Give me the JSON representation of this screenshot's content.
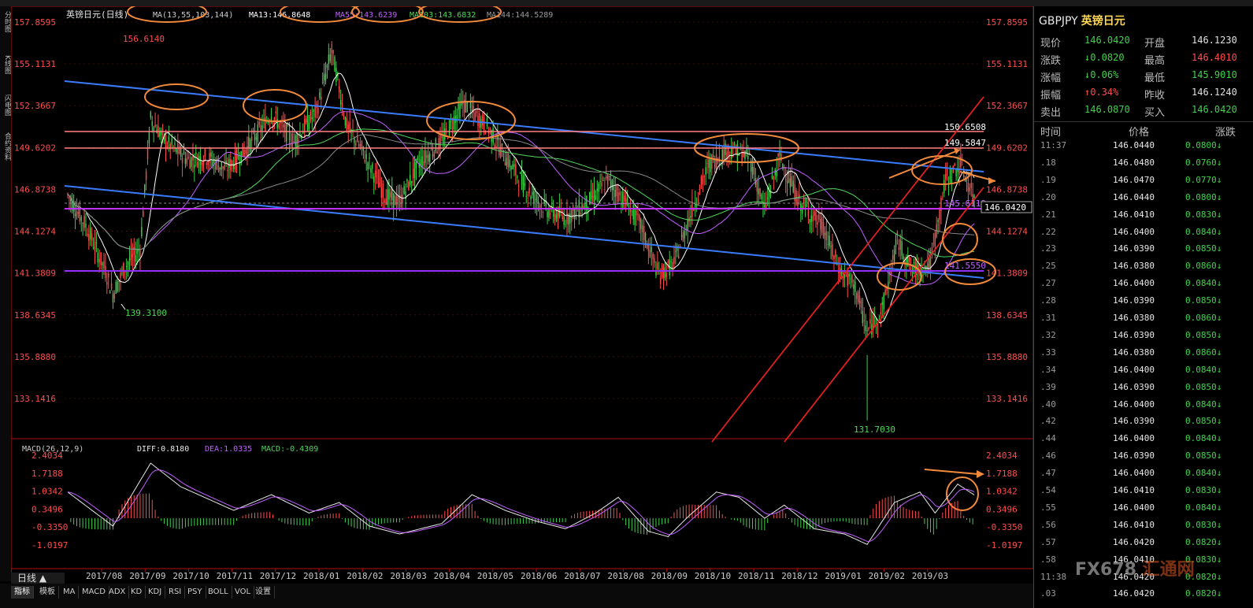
{
  "symbol": "GBPJPY",
  "name": "英镑日元",
  "chart_title": "英镑日元(日线)",
  "ma": {
    "params": "MA(13,55,103,144)",
    "ma13": "MA13:146.8648",
    "ma55": "MA55:143.6239",
    "ma103": "MA103:143.6832",
    "ma144": "MA144:144.5289"
  },
  "macd": {
    "params": "MACD(26,12,9)",
    "diff": "DIFF:0.8180",
    "dea": "DEA:1.0335",
    "macd": "MACD:-0.4309"
  },
  "price_axis": [
    "157.8595",
    "155.1131",
    "152.3667",
    "149.6202",
    "146.8738",
    "144.1274",
    "141.3809",
    "138.6345",
    "135.8880",
    "133.1416"
  ],
  "macd_axis": [
    "2.4034",
    "1.7188",
    "1.0342",
    "0.3496",
    "-0.3350",
    "-1.0197"
  ],
  "date_axis": [
    "2017/08",
    "2017/09",
    "2017/10",
    "2017/11",
    "2017/12",
    "2018/01",
    "2018/02",
    "2018/03",
    "2018/04",
    "2018/05",
    "2018/06",
    "2018/07",
    "2018/08",
    "2018/09",
    "2018/10",
    "2018/11",
    "2018/12",
    "2019/01",
    "2019/02",
    "2019/03"
  ],
  "annotations": {
    "high": "156.6140",
    "low1": "139.3100",
    "low2": "131.7030",
    "lvl1": "150.6508",
    "lvl2": "149.5847",
    "lvl3": "145.6119",
    "lvl4": "141.5550",
    "current": "146.0420"
  },
  "quote": {
    "rows": [
      {
        "l1": "现价",
        "v1": "146.0420",
        "c1": "#3fd24a",
        "l2": "开盘",
        "v2": "146.1230",
        "c2": "#e0e0e0"
      },
      {
        "l1": "涨跌",
        "v1": "↓0.0820",
        "c1": "#3fd24a",
        "l2": "最高",
        "v2": "146.4010",
        "c2": "#ff4d4d"
      },
      {
        "l1": "涨幅",
        "v1": "↓0.06%",
        "c1": "#3fd24a",
        "l2": "最低",
        "v2": "145.9010",
        "c2": "#3fd24a"
      },
      {
        "l1": "振幅",
        "v1": "↑0.34%",
        "c1": "#ff4d4d",
        "l2": "昨收",
        "v2": "146.1240",
        "c2": "#e0e0e0"
      },
      {
        "l1": "卖出",
        "v1": "146.0870",
        "c1": "#3fd24a",
        "l2": "买入",
        "v2": "146.0420",
        "c2": "#3fd24a"
      }
    ],
    "tick_headers": [
      "时间",
      "价格",
      "涨跌"
    ],
    "ticks": [
      {
        "t": "11:37",
        "p": "146.0440",
        "c": "0.0800↓"
      },
      {
        "t": ".18",
        "p": "146.0480",
        "c": "0.0760↓"
      },
      {
        "t": ".19",
        "p": "146.0470",
        "c": "0.0770↓"
      },
      {
        "t": ".20",
        "p": "146.0440",
        "c": "0.0800↓"
      },
      {
        "t": ".21",
        "p": "146.0410",
        "c": "0.0830↓"
      },
      {
        "t": ".22",
        "p": "146.0400",
        "c": "0.0840↓"
      },
      {
        "t": ".23",
        "p": "146.0390",
        "c": "0.0850↓"
      },
      {
        "t": ".25",
        "p": "146.0380",
        "c": "0.0860↓"
      },
      {
        "t": ".27",
        "p": "146.0400",
        "c": "0.0840↓"
      },
      {
        "t": ".28",
        "p": "146.0390",
        "c": "0.0850↓"
      },
      {
        "t": ".31",
        "p": "146.0380",
        "c": "0.0860↓"
      },
      {
        "t": ".32",
        "p": "146.0390",
        "c": "0.0850↓"
      },
      {
        "t": ".33",
        "p": "146.0380",
        "c": "0.0860↓"
      },
      {
        "t": ".34",
        "p": "146.0400",
        "c": "0.0840↓"
      },
      {
        "t": ".39",
        "p": "146.0390",
        "c": "0.0850↓"
      },
      {
        "t": ".40",
        "p": "146.0400",
        "c": "0.0840↓"
      },
      {
        "t": ".42",
        "p": "146.0390",
        "c": "0.0850↓"
      },
      {
        "t": ".44",
        "p": "146.0400",
        "c": "0.0840↓"
      },
      {
        "t": ".46",
        "p": "146.0390",
        "c": "0.0850↓"
      },
      {
        "t": ".47",
        "p": "146.0400",
        "c": "0.0840↓"
      },
      {
        "t": ".54",
        "p": "146.0410",
        "c": "0.0830↓"
      },
      {
        "t": ".55",
        "p": "146.0400",
        "c": "0.0840↓"
      },
      {
        "t": ".56",
        "p": "146.0410",
        "c": "0.0830↓"
      },
      {
        "t": ".57",
        "p": "146.0420",
        "c": "0.0820↓"
      },
      {
        "t": ".58",
        "p": "146.0410",
        "c": "0.0830↓"
      },
      {
        "t": "11:38",
        "p": "146.0420",
        "c": "0.0820↓"
      },
      {
        "t": ".03",
        "p": "146.0420",
        "c": "0.0820↓"
      }
    ]
  },
  "left_tabs": [
    "分时图",
    "K线图",
    "闪电图",
    "合约资料"
  ],
  "period": "日线 ▲",
  "bottom_tabs": [
    "指标",
    "模板",
    "MA",
    "MACD",
    "ADX",
    "KD",
    "KDJ",
    "RSI",
    "PSY",
    "BOLL",
    "VOL",
    "设置"
  ],
  "watermark": {
    "a": "FX678",
    "b": "汇通网"
  },
  "colors": {
    "up": "#ff4d4d",
    "down": "#3fd24a",
    "accent": "#f28a3b",
    "trend_blue": "#3a7cff",
    "channel_red": "#e02020",
    "support_purple": "#b040ff",
    "pink": "#ff8080"
  }
}
